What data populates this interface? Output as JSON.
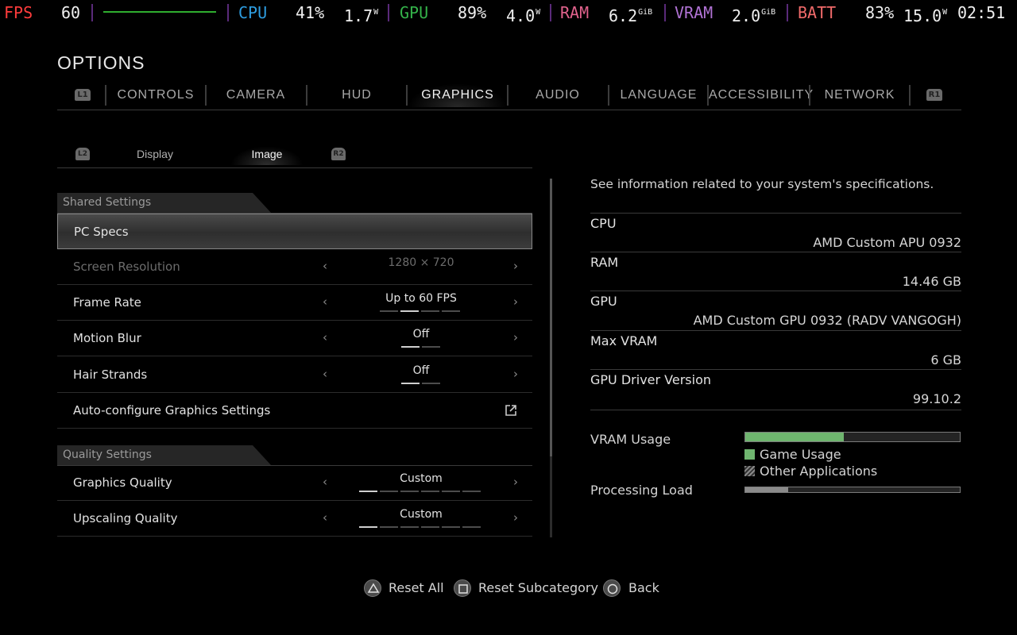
{
  "overlay": {
    "fps_label": "FPS",
    "fps_value": "60",
    "cpu_label": "CPU",
    "cpu_value": "41%",
    "cpu_power": "1.7",
    "cpu_power_unit": "W",
    "gpu_label": "GPU",
    "gpu_value": "89%",
    "gpu_power": "4.0",
    "gpu_power_unit": "W",
    "ram_label": "RAM",
    "ram_value": "6.2",
    "ram_unit": "GiB",
    "vram_label": "VRAM",
    "vram_value": "2.0",
    "vram_unit": "GiB",
    "batt_label": "BATT",
    "batt_value": "83%",
    "batt_power": "15.0",
    "batt_power_unit": "W",
    "clock": "02:51",
    "colors": {
      "fps": "#ff3c3c",
      "cpu": "#2e9de0",
      "gpu": "#34b34a",
      "ram": "#e0628c",
      "vram": "#b072d4",
      "batt": "#f06a6a"
    }
  },
  "page": {
    "title": "OPTIONS"
  },
  "tabs": {
    "left_shoulder": "L1",
    "right_shoulder": "R1",
    "items": [
      {
        "label": "CONTROLS"
      },
      {
        "label": "CAMERA"
      },
      {
        "label": "HUD"
      },
      {
        "label": "GRAPHICS",
        "active": true
      },
      {
        "label": "AUDIO"
      },
      {
        "label": "LANGUAGE"
      },
      {
        "label": "ACCESSIBILITY"
      },
      {
        "label": "NETWORK"
      }
    ]
  },
  "subtabs": {
    "left_trigger": "L2",
    "right_trigger": "R2",
    "items": [
      {
        "label": "Display"
      },
      {
        "label": "Image",
        "active": true
      }
    ]
  },
  "shared_settings": {
    "header": "Shared Settings",
    "rows": [
      {
        "label": "PC Specs",
        "selected": true
      },
      {
        "label": "Screen Resolution",
        "value": "1280 × 720",
        "disabled": true
      },
      {
        "label": "Frame Rate",
        "value": "Up to 60 FPS",
        "levels": 4,
        "level": 2
      },
      {
        "label": "Motion Blur",
        "value": "Off",
        "levels": 2,
        "level": 1
      },
      {
        "label": "Hair Strands",
        "value": "Off",
        "levels": 2,
        "level": 1
      },
      {
        "label": "Auto-configure Graphics Settings",
        "icon": "external-link-icon"
      }
    ]
  },
  "quality_settings": {
    "header": "Quality Settings",
    "rows": [
      {
        "label": "Graphics Quality",
        "value": "Custom",
        "levels": 6,
        "level": 1
      },
      {
        "label": "Upscaling Quality",
        "value": "Custom",
        "levels": 6,
        "level": 1
      }
    ]
  },
  "specs_panel": {
    "description": "See information related to your system's specifications.",
    "items": [
      {
        "key": "CPU",
        "value": "AMD Custom APU 0932"
      },
      {
        "key": "RAM",
        "value": "14.46 GB"
      },
      {
        "key": "GPU",
        "value": "AMD Custom GPU 0932 (RADV VANGOGH)"
      },
      {
        "key": "Max VRAM",
        "value": "6 GB"
      },
      {
        "key": "GPU Driver Version",
        "value": "99.10.2"
      }
    ],
    "vram_usage_label": "VRAM Usage",
    "vram_game_fraction": 0.46,
    "legend_game": "Game Usage",
    "legend_other": "Other Applications",
    "processing_load_label": "Processing Load",
    "processing_load_fraction": 0.2
  },
  "footer": {
    "reset_all": "Reset All",
    "reset_subcategory": "Reset Subcategory",
    "back": "Back"
  }
}
